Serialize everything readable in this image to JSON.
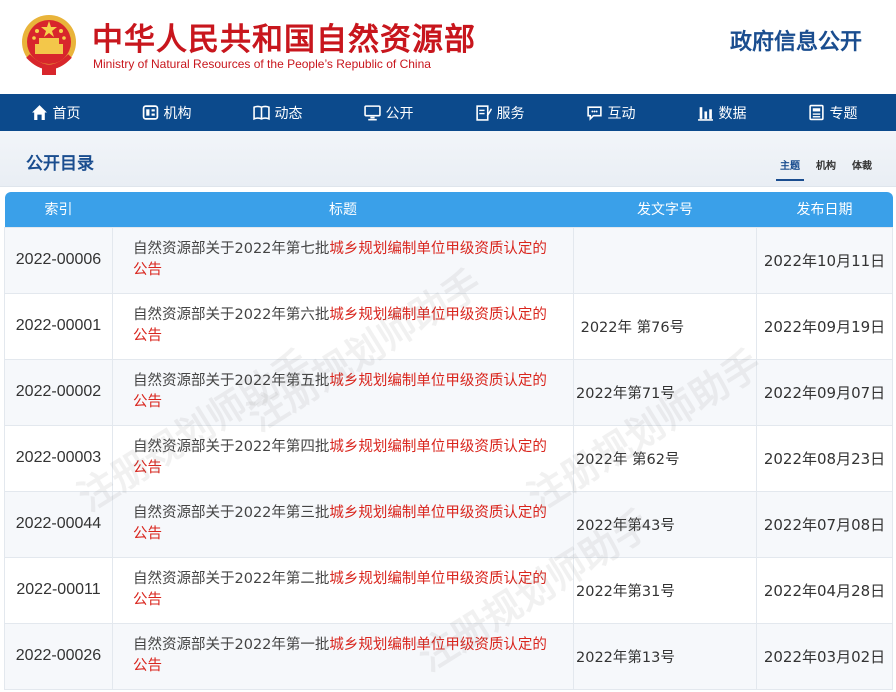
{
  "header": {
    "title": "中华人民共和国自然资源部",
    "subtitle": "Ministry of Natural Resources of the People’s Republic of China",
    "gov_info": "政府信息公开"
  },
  "nav": [
    {
      "label": "首页",
      "icon": "home-icon"
    },
    {
      "label": "机构",
      "icon": "org-icon"
    },
    {
      "label": "动态",
      "icon": "book-icon"
    },
    {
      "label": "公开",
      "icon": "monitor-icon"
    },
    {
      "label": "服务",
      "icon": "edit-icon"
    },
    {
      "label": "互动",
      "icon": "chat-icon"
    },
    {
      "label": "数据",
      "icon": "bar-chart-icon"
    },
    {
      "label": "专题",
      "icon": "topic-icon"
    }
  ],
  "section": {
    "title": "公开目录",
    "tabs": [
      "主题",
      "机构",
      "体裁"
    ],
    "active_tab": "主题"
  },
  "table": {
    "headers": [
      "索引",
      "标题",
      "发文字号",
      "发布日期"
    ],
    "rows": [
      {
        "index": "2022-00006",
        "title_plain": "自然资源部关于2022年第七批",
        "title_hl": "城乡规划编制单位甲级资质认定的公告",
        "docno": "",
        "date": "2022年10月11日"
      },
      {
        "index": "2022-00001",
        "title_plain": "自然资源部关于2022年第六批",
        "title_hl": "城乡规划编制单位甲级资质认定的公告",
        "docno": " 2022年 第76号",
        "date": "2022年09月19日"
      },
      {
        "index": "2022-00002",
        "title_plain": "自然资源部关于2022年第五批",
        "title_hl": "城乡规划编制单位甲级资质认定的公告",
        "docno": "2022年第71号",
        "date": "2022年09月07日"
      },
      {
        "index": "2022-00003",
        "title_plain": "自然资源部关于2022年第四批",
        "title_hl": "城乡规划编制单位甲级资质认定的公告",
        "docno": "2022年 第62号",
        "date": "2022年08月23日"
      },
      {
        "index": "2022-00044",
        "title_plain": "自然资源部关于2022年第三批",
        "title_hl": "城乡规划编制单位甲级资质认定的公告",
        "docno": "2022年第43号",
        "date": "2022年07月08日"
      },
      {
        "index": "2022-00011",
        "title_plain": "自然资源部关于2022年第二批",
        "title_hl": "城乡规划编制单位甲级资质认定的公告",
        "docno": "2022年第31号",
        "date": "2022年04月28日"
      },
      {
        "index": "2022-00026",
        "title_plain": "自然资源部关于2022年第一批",
        "title_hl": "城乡规划编制单位甲级资质认定的公告",
        "docno": "2022年第13号",
        "date": "2022年03月02日"
      }
    ]
  },
  "watermark": "注册规划师助手",
  "colors": {
    "brand_red": "#c8161d",
    "nav_blue": "#0c4a8c",
    "table_header": "#3aa0e9",
    "highlight": "#d9251d"
  }
}
